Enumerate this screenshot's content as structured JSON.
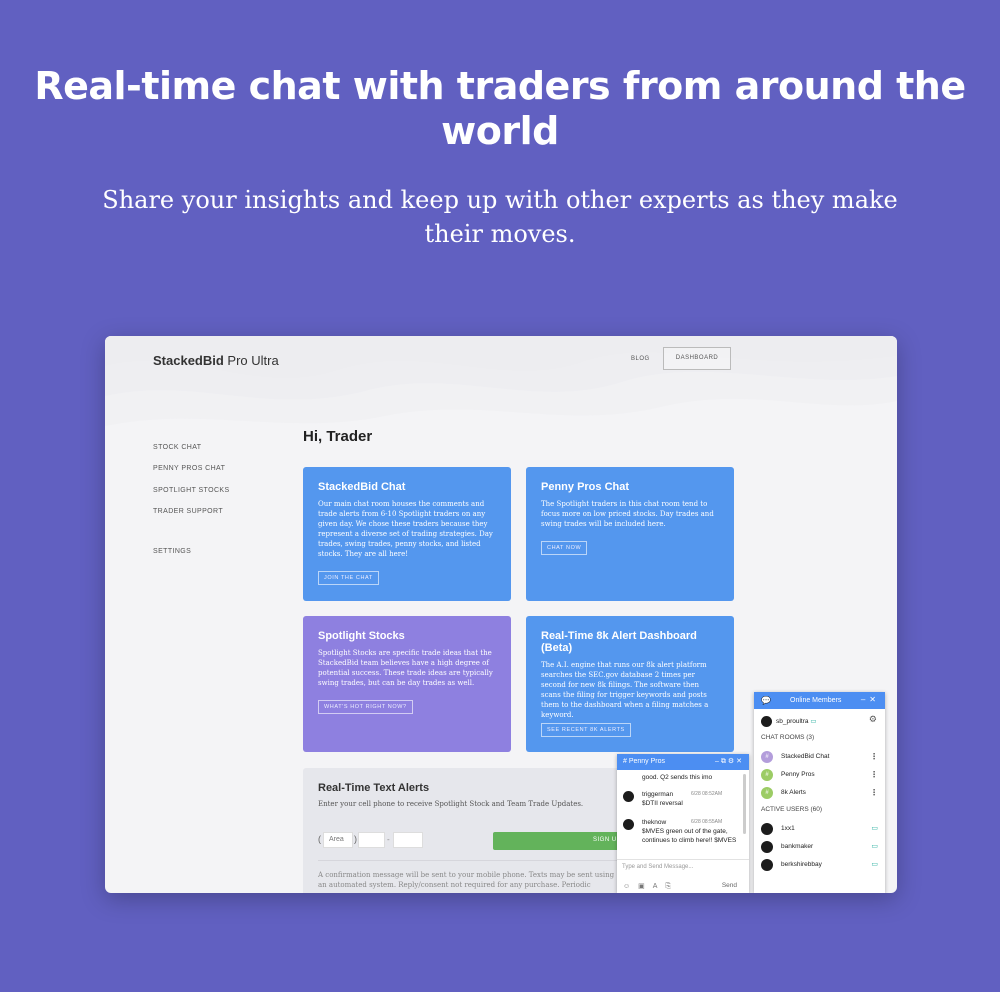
{
  "hero": {
    "title": "Real-time chat with traders from around the world",
    "subtitle": "Share your insights and keep up with other experts as they make their moves."
  },
  "app": {
    "brand_bold": "StackedBid",
    "brand_rest": " Pro Ultra",
    "nav": {
      "blog": "BLOG",
      "dashboard": "DASHBOARD"
    },
    "sidebar": [
      "STOCK CHAT",
      "PENNY PROS CHAT",
      "SPOTLIGHT STOCKS",
      "TRADER SUPPORT",
      "SETTINGS"
    ],
    "greeting": "Hi, Trader",
    "cards": [
      {
        "title": "StackedBid Chat",
        "body": "Our main chat room houses the comments and trade alerts from 6-10 Spotlight traders on any given day. We chose these traders because they represent a diverse set of trading strategies. Day trades, swing trades, penny stocks, and listed stocks. They are all here!",
        "button": "JOIN THE CHAT"
      },
      {
        "title": "Penny Pros Chat",
        "body": "The Spotlight traders in this chat room tend to focus more on low priced stocks. Day trades and swing trades will be included here.",
        "button": "CHAT NOW"
      },
      {
        "title": "Spotlight Stocks",
        "body": "Spotlight Stocks are specific trade ideas that the StackedBid team believes have a high degree of potential success. These trade ideas are typically swing trades, but can be day trades as well.",
        "button": "WHAT'S HOT RIGHT NOW?"
      },
      {
        "title": "Real-Time 8k Alert Dashboard (Beta)",
        "body": "The A.I. engine that runs our 8k alert platform searches the SEC.gov database 2 times per second for new 8k filings. The software then scans the filing for trigger keywords and posts them to the dashboard when a filing matches a keyword.",
        "button": "SEE RECENT 8K ALERTS"
      }
    ],
    "alerts": {
      "title": "Real-Time Text Alerts",
      "subtitle": "Enter your cell phone to receive Spotlight Stock and Team Trade Updates.",
      "area_placeholder": "Area",
      "signup": "SIGN UP",
      "confirm": "A confirmation message will be sent to your mobile phone. Texts may be sent using an automated system. Reply/consent not required for any purchase. Periodic messages."
    }
  },
  "chat": {
    "title": "# Penny Pros",
    "messages": [
      {
        "user": "",
        "time": "",
        "text": "good. Q2 sends this imo"
      },
      {
        "user": "triggerman",
        "time": "6/28 08:52AM",
        "text": "$DTII reversal"
      },
      {
        "user": "theknow",
        "time": "6/28 08:55AM",
        "text": "$MVES green out of the gate, continues to climb here!! $MVES"
      }
    ],
    "input_placeholder": "Type and Send Message...",
    "send": "Send"
  },
  "members": {
    "title": "Online Members",
    "me": "sb_proultra",
    "rooms_header": "CHAT ROOMS (3)",
    "rooms": [
      {
        "name": "StackedBid Chat",
        "color": "#b39ddb"
      },
      {
        "name": "Penny Pros",
        "color": "#9ccc65"
      },
      {
        "name": "8k Alerts",
        "color": "#9ccc65"
      }
    ],
    "users_header": "ACTIVE USERS (60)",
    "users": [
      "1xx1",
      "bankmaker",
      "berkshirebbay"
    ]
  }
}
